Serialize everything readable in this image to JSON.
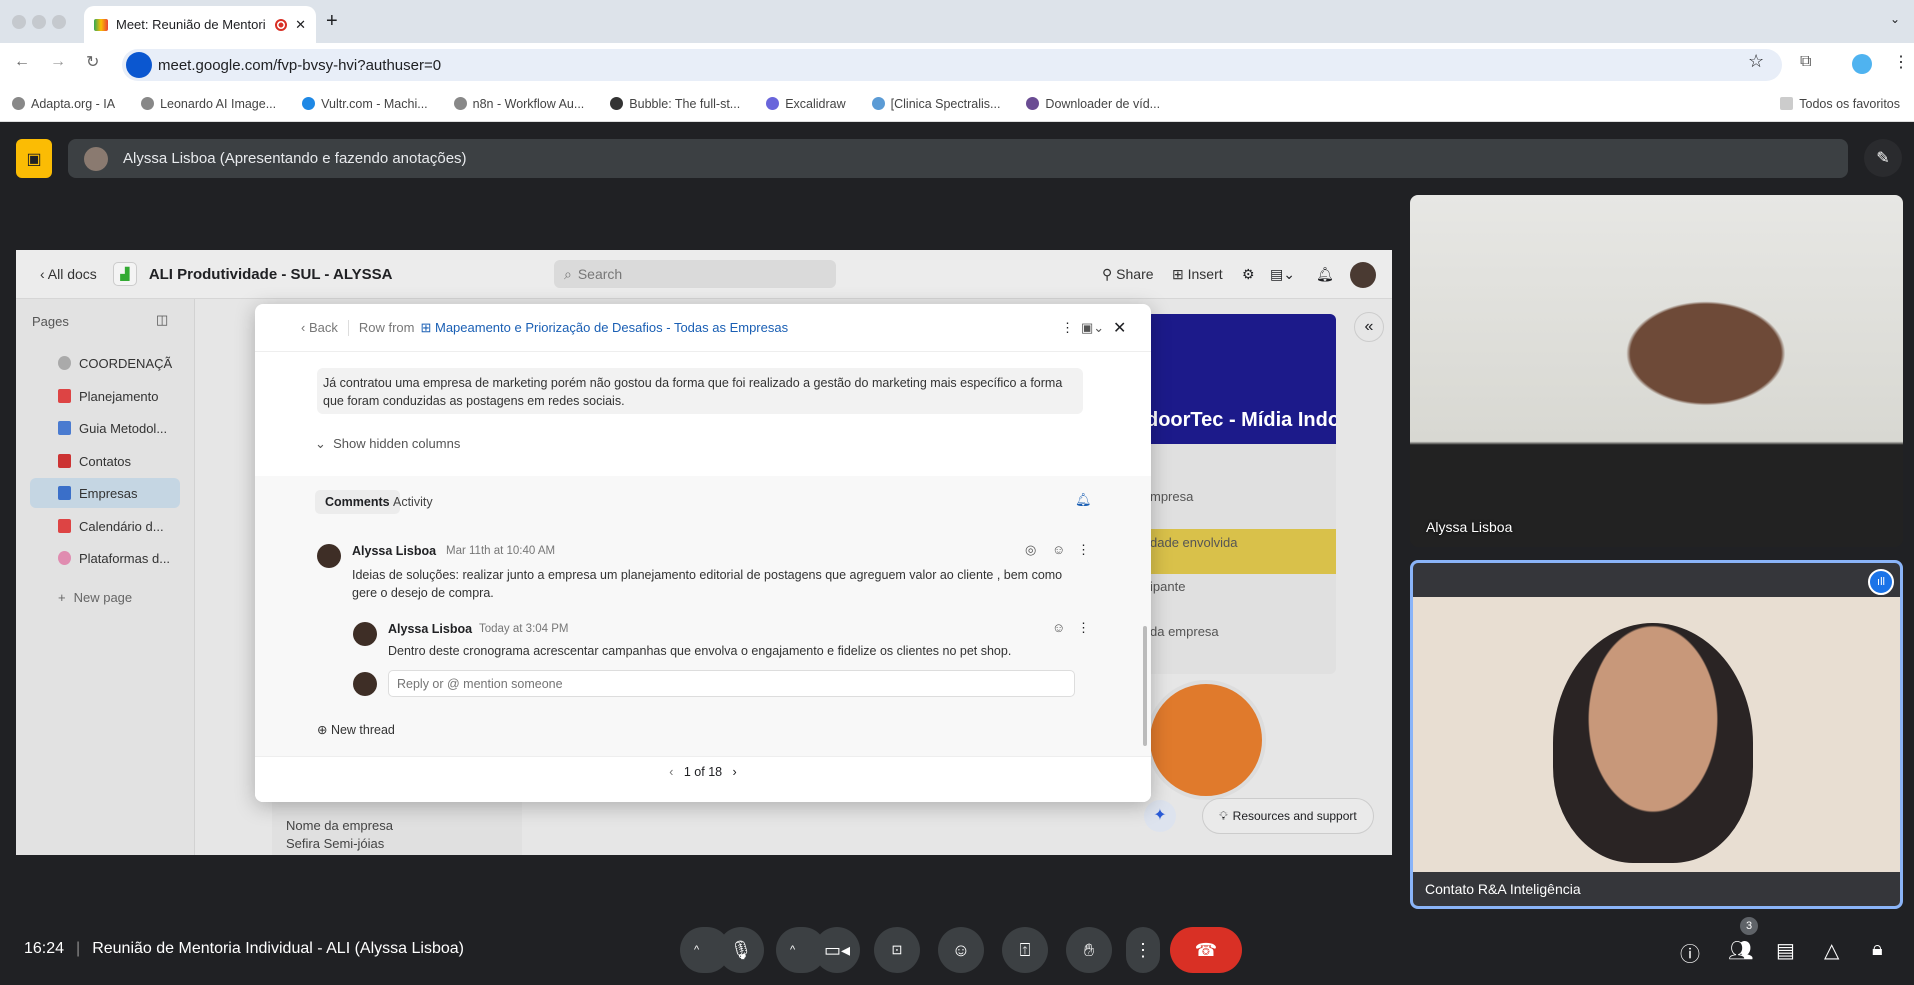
{
  "browser": {
    "tab_title": "Meet: Reunião de Mentori",
    "url": "meet.google.com/fvp-bvsy-hvi?authuser=0",
    "bookmarks": [
      "Adapta.org - IA",
      "Leonardo AI Image...",
      "Vultr.com - Machi...",
      "n8n - Workflow Au...",
      "Bubble: The full-st...",
      "Excalidraw",
      "[Clinica Spectralis...",
      "Downloader de víd..."
    ],
    "all_bookmarks": "Todos os favoritos"
  },
  "meet": {
    "presenter": "Alyssa Lisboa (Apresentando e fazendo anotações)",
    "time": "16:24",
    "meeting_title": "Reunião de Mentoria Individual - ALI (Alyssa Lisboa)",
    "participant_count": "3",
    "tiles": [
      {
        "name": "Alyssa Lisboa"
      },
      {
        "name": "Contato R&A Inteligência"
      }
    ],
    "accent": "#8ab4f8",
    "end_call_color": "#d93025"
  },
  "doc": {
    "all_docs": "All docs",
    "title": "ALI Produtividade - SUL - ALYSSA",
    "search_placeholder": "Search",
    "share": "Share",
    "insert": "Insert",
    "pages_label": "Pages",
    "pages": [
      "COORDENAÇÃ",
      "Planejamento",
      "Guia Metodol...",
      "Contatos",
      "Empresas",
      "Calendário d...",
      "Plataformas d..."
    ],
    "new_page": "New page",
    "cards": {
      "brand": "doorTec - Mídia Indoor",
      "f1": "mpresa",
      "f2": "dade envolvida",
      "f3": "ipante",
      "f4": "da empresa",
      "nome_label": "Nome da empresa",
      "nome_value": "Sefira Semi-jóias"
    },
    "resources": "Resources and support"
  },
  "modal": {
    "back": "Back",
    "row_from": "Row from",
    "table_link": "Mapeamento e Priorização de Desafios - Todas as Empresas",
    "cell_text": "Já contratou uma empresa de marketing porém não gostou da forma que foi realizado a gestão do marketing mais específico a forma que foram conduzidas as postagens em redes sociais.",
    "show_hidden": "Show hidden columns",
    "tabs": [
      "Comments",
      "Activity"
    ],
    "comments": [
      {
        "author": "Alyssa Lisboa",
        "time": "Mar 11th at 10:40 AM",
        "text": "Ideias de soluções:  realizar junto a empresa um planejamento editorial de postagens que agreguem valor ao cliente , bem como gere o desejo de compra."
      },
      {
        "author": "Alyssa Lisboa",
        "time": "Today at 3:04 PM",
        "text": "Dentro deste cronograma acrescentar campanhas que envolva o engajamento e fidelize os clientes no pet shop."
      }
    ],
    "reply_placeholder": "Reply or @ mention someone",
    "new_thread": "New thread",
    "pager": "1 of 18"
  }
}
